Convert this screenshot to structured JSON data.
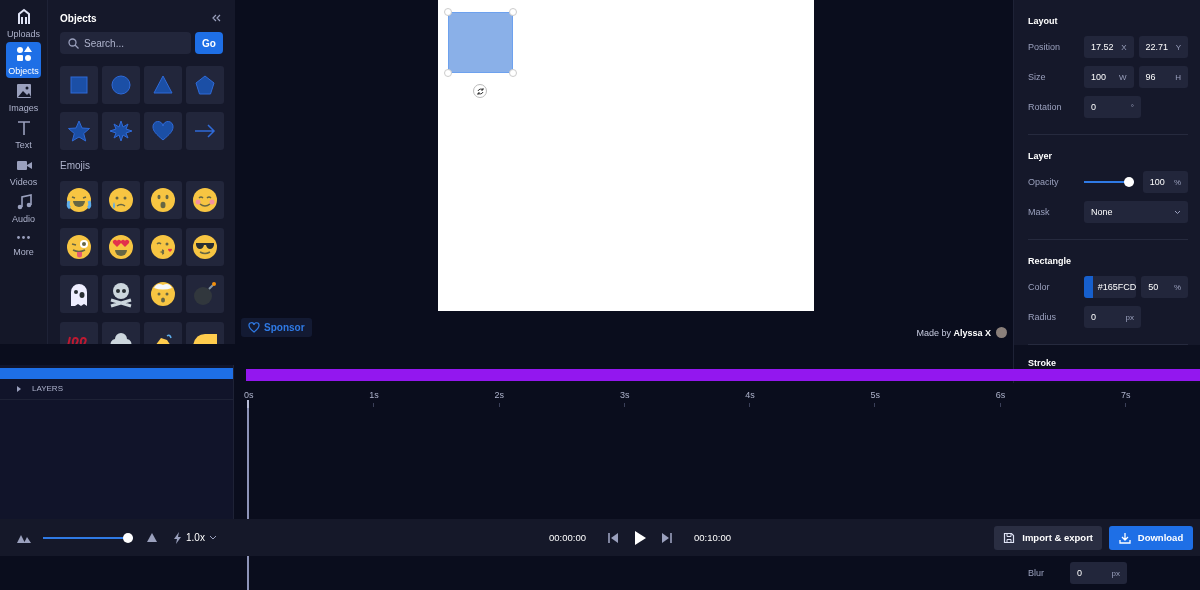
{
  "rail": [
    {
      "label": "Uploads",
      "selected": false
    },
    {
      "label": "Objects",
      "selected": true
    },
    {
      "label": "Images",
      "selected": false
    },
    {
      "label": "Text",
      "selected": false
    },
    {
      "label": "Videos",
      "selected": false
    },
    {
      "label": "Audio",
      "selected": false
    },
    {
      "label": "More",
      "selected": false
    }
  ],
  "objects_panel": {
    "title": "Objects",
    "search": {
      "placeholder": "Search..."
    },
    "go": "Go",
    "emojis_title": "Emojis"
  },
  "canvas": {
    "sponsor": "Sponsor",
    "credit": "Made by **Alyssa X**"
  },
  "properties": {
    "sections": [
      {
        "title": "Layout",
        "rows": [
          {
            "kind": "pair",
            "label": "Position",
            "fields": [
              {
                "value": "17.52",
                "unit": "X"
              },
              {
                "value": "22.71",
                "unit": "Y"
              }
            ]
          },
          {
            "kind": "pair",
            "label": "Size",
            "fields": [
              {
                "value": "100",
                "unit": "W"
              },
              {
                "value": "96",
                "unit": "H"
              }
            ]
          },
          {
            "kind": "pair",
            "label": "Rotation",
            "fields": [
              {
                "value": "0",
                "unit": "°"
              }
            ]
          }
        ]
      },
      {
        "title": "Layer",
        "rows": [
          {
            "kind": "slider",
            "label": "Opacity",
            "level": 1,
            "fields": [
              {
                "value": "100",
                "unit": "%"
              }
            ]
          },
          {
            "kind": "select",
            "label": "Mask",
            "value": "None"
          }
        ]
      },
      {
        "title": "Rectangle",
        "rows": [
          {
            "kind": "color",
            "label": "Color",
            "hex": "#165FCD",
            "fields": [
              {
                "value": "50",
                "unit": "%"
              }
            ]
          },
          {
            "kind": "pair",
            "label": "Radius",
            "fields": [
              {
                "value": "0",
                "unit": "px"
              }
            ]
          }
        ]
      },
      {
        "title": "Stroke"
      }
    ]
  },
  "timeline": {
    "layers_label": "LAYERS",
    "ticks": [
      "0s",
      "1s",
      "2s",
      "3s",
      "4s",
      "5s",
      "6s",
      "7s"
    ]
  },
  "controls": {
    "zoom": {
      "level": 1
    },
    "speed": "1.0x",
    "current": "00:00:00",
    "total": "00:10:00",
    "import": "Import & export",
    "download": "Download"
  },
  "blur": {
    "label": "Blur",
    "value": "0",
    "unit": "px"
  }
}
